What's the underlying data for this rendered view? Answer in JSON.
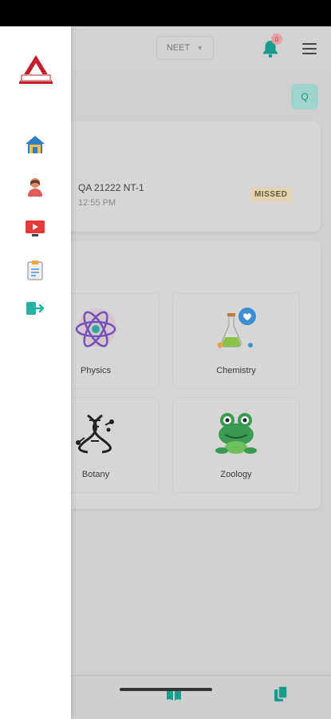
{
  "header": {
    "exam_selector": "NEET",
    "notification_count": "0",
    "accent": "#1a9c8a"
  },
  "search": {
    "label": "Q"
  },
  "test_card": {
    "name": "QA 21222 NT-1",
    "time": "12:55 PM",
    "status": "MISSED"
  },
  "subjects": [
    {
      "label": "Physics",
      "icon": "atom-icon"
    },
    {
      "label": "Chemistry",
      "icon": "flask-icon"
    },
    {
      "label": "Botany",
      "icon": "dna-icon"
    },
    {
      "label": "Zoology",
      "icon": "frog-icon"
    }
  ],
  "drawer": {
    "items": [
      {
        "icon": "home-icon"
      },
      {
        "icon": "profile-icon"
      },
      {
        "icon": "video-icon"
      },
      {
        "icon": "clipboard-icon"
      },
      {
        "icon": "logout-icon"
      }
    ]
  },
  "bottom_nav": [
    {
      "icon": "book-icon"
    },
    {
      "icon": "documents-icon"
    }
  ]
}
